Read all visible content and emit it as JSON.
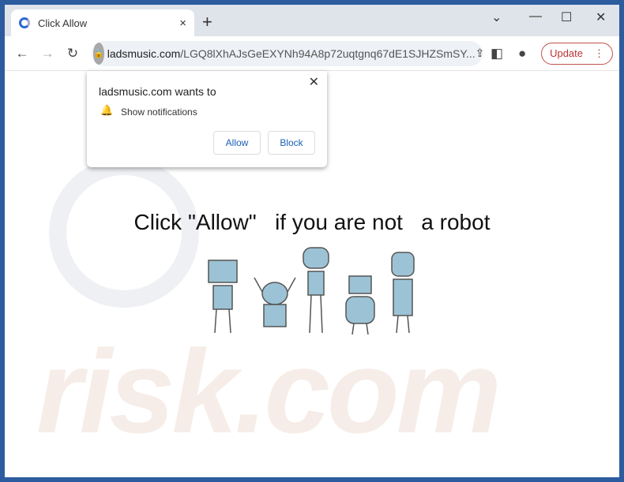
{
  "tab": {
    "title": "Click Allow",
    "close": "×",
    "new": "+"
  },
  "window": {
    "dropdown": "⌄",
    "minimize": "—",
    "maximize": "☐",
    "close": "✕"
  },
  "toolbar": {
    "back": "←",
    "forward": "→",
    "reload": "↻",
    "domain": "ladsmusic.com",
    "path": "/LGQ8lXhAJsGeEXYNh94A8p72uqtgnq67dE1SJHZSmSY...",
    "update": "Update"
  },
  "popup": {
    "title": "ladsmusic.com wants to",
    "permission": "Show notifications",
    "allow": "Allow",
    "block": "Block",
    "close": "✕"
  },
  "page": {
    "headline": "Click \"Allow\"   if you are not   a robot",
    "watermark": "risk.com"
  },
  "colors": {
    "frame": "#2c5c9e",
    "robot": "#9cc3d5",
    "button_text": "#1a5fb4"
  }
}
